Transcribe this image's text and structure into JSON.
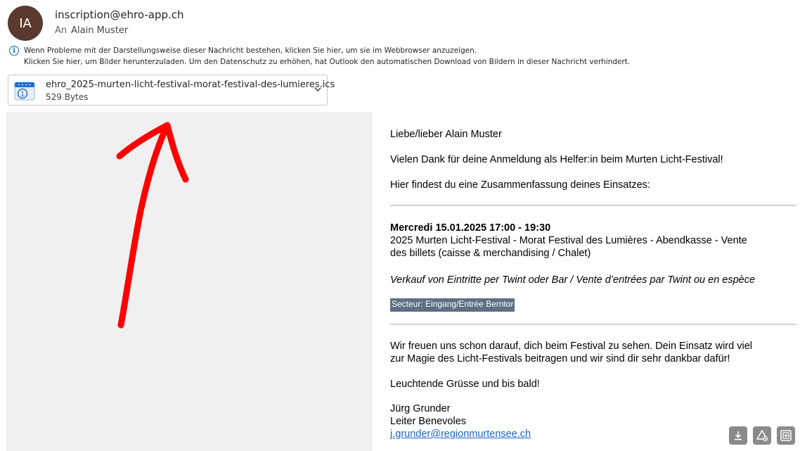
{
  "header": {
    "avatar_initials": "IA",
    "sender": "inscription@ehro-app.ch",
    "to_label": "An",
    "recipient": "Alain Muster"
  },
  "info_bar": {
    "icon": "info-icon",
    "line1": "Wenn Probleme mit der Darstellungsweise dieser Nachricht bestehen, klicken Sie hier, um sie im Webbrowser anzuzeigen.",
    "line2": "Klicken Sie hier, um Bilder herunterzuladen. Um den Datenschutz zu erhöhen, hat Outlook den automatischen Download von Bildern in dieser Nachricht verhindert."
  },
  "attachment": {
    "icon": "calendar-icon",
    "filename": "ehro_2025-murten-licht-festival-morat-festival-des-lumieres.ics",
    "size": "529 Bytes"
  },
  "body": {
    "greeting": "Liebe/lieber Alain Muster",
    "thanks": "Vielen Dank für deine Anmeldung als Helfer:in beim Murten Licht-Festival!",
    "summary_intro": "Hier findest du eine Zusammenfassung deines Einsatzes:",
    "shift": {
      "datetime": "Mercredi 15.01.2025 17:00 - 19:30",
      "line1": "2025 Murten Licht-Festival - Morat Festival des Lumières - Abendkasse - Vente",
      "line2": "des billets (caisse & merchandising / Chalet)",
      "task": "Verkauf von Eintritte per Twint oder Bar / Vente d’entrées par Twint ou en espèce",
      "sector": "Secteur: Eingang/Entrée Berntor"
    },
    "closing1": "Wir freuen uns schon darauf, dich beim Festival zu sehen. Dein Einsatz wird viel",
    "closing2": "zur Magie des Licht-Festivals beitragen und wir sind dir sehr dankbar dafür!",
    "farewell": "Leuchtende Grüsse und bis bald!",
    "signature_name": "Jürg Grunder",
    "signature_title": "Leiter Benevoles",
    "signature_email": "j.grunder@regionmurtensee.ch"
  },
  "annotation": {
    "arrow_color": "#ff0000"
  },
  "toolbar": {
    "icons": [
      "download-icon",
      "recycle-icon",
      "add-icon"
    ]
  }
}
